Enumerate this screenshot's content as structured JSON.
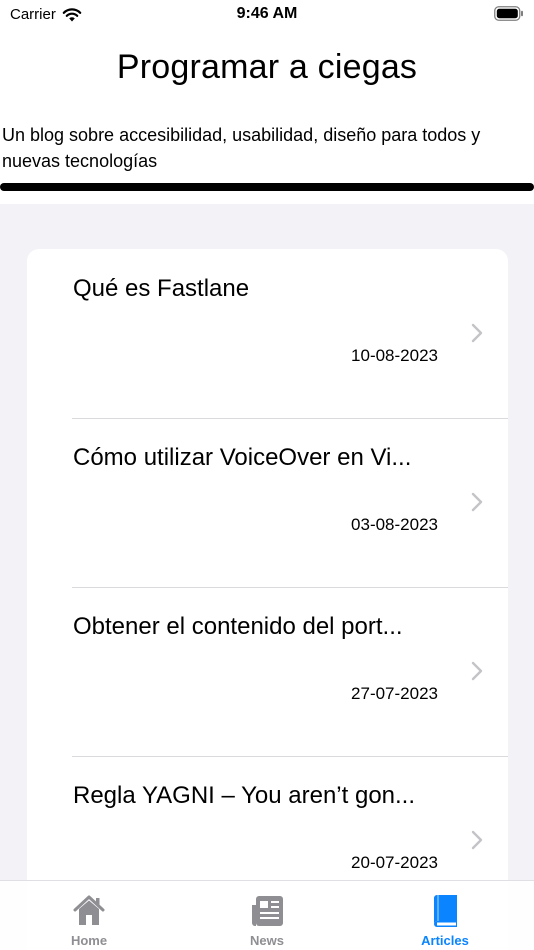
{
  "status_bar": {
    "carrier": "Carrier",
    "time": "9:46 AM"
  },
  "header": {
    "title": "Programar a ciegas",
    "subtitle": "Un blog sobre accesibilidad, usabilidad, diseño para todos y nuevas tecnologías"
  },
  "articles": [
    {
      "title": "Qué es Fastlane",
      "date": "10-08-2023"
    },
    {
      "title": "Cómo utilizar VoiceOver en Vi...",
      "date": "03-08-2023"
    },
    {
      "title": "Obtener el contenido del port...",
      "date": "27-07-2023"
    },
    {
      "title": "Regla YAGNI – You aren’t gon...",
      "date": "20-07-2023"
    }
  ],
  "tabs": [
    {
      "label": "Home",
      "icon": "house-icon"
    },
    {
      "label": "News",
      "icon": "newspaper-icon"
    },
    {
      "label": "Articles",
      "icon": "book-icon",
      "active": true
    }
  ],
  "colors": {
    "accent": "#0a84ff",
    "inactive": "#8e8e93",
    "background": "#f2f2f7"
  }
}
